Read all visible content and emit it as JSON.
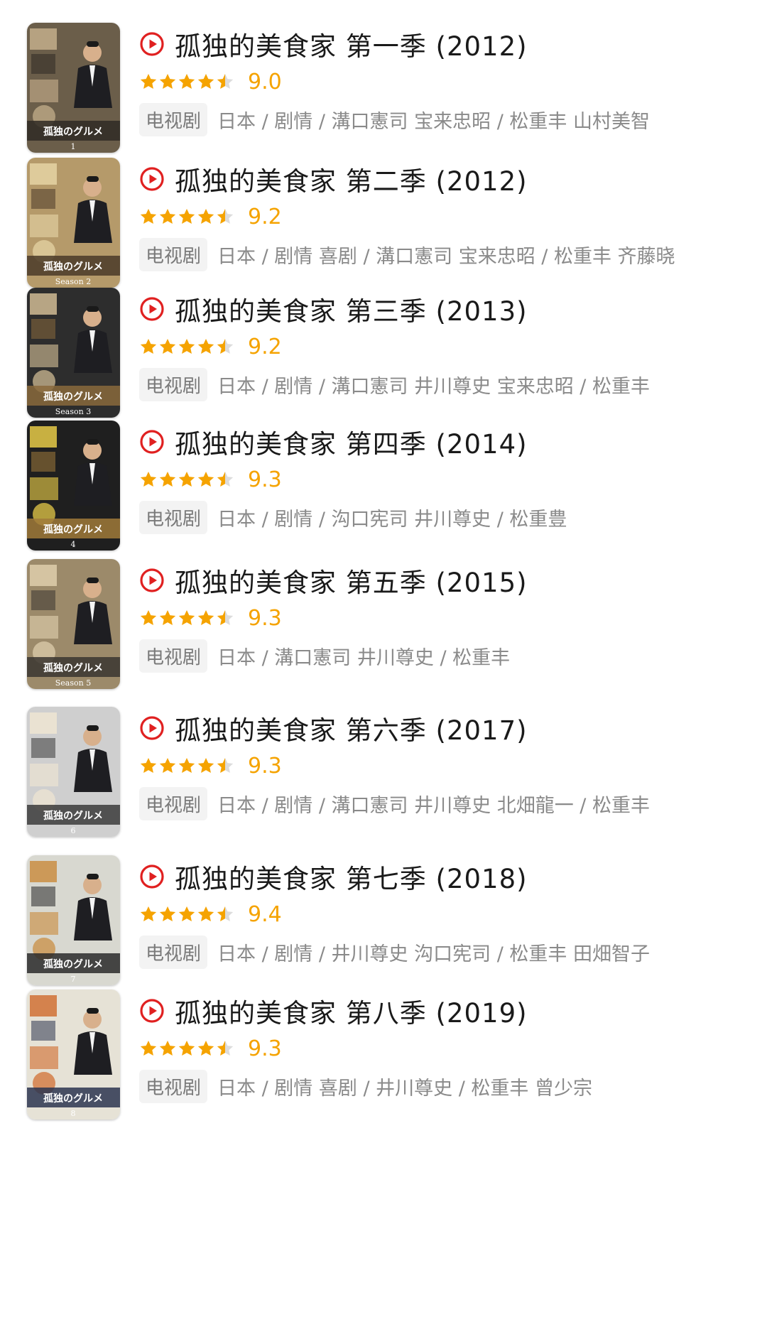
{
  "colors": {
    "accent_red": "#e02020",
    "star_orange": "#f5a300",
    "title_text": "#1a1a1a",
    "meta_text": "#8a8a8a"
  },
  "icons": {
    "play": "play-circle-icon",
    "star": "star-icon"
  },
  "items": [
    {
      "title": "孤独的美食家 第一季 (2012)",
      "rating_stars": 4.5,
      "score": "9.0",
      "tag": "电视剧",
      "meta": "日本 / 剧情 / 溝口憲司 宝来忠昭 / 松重丰 山村美智",
      "poster_palette": [
        "#6b5e4a",
        "#2f2a24",
        "#c9b38f"
      ],
      "poster_text": "1"
    },
    {
      "title": "孤独的美食家 第二季 (2012)",
      "rating_stars": 4.5,
      "score": "9.2",
      "tag": "电视剧",
      "meta": "日本 / 剧情 喜剧 / 溝口憲司 宝来忠昭 / 松重丰 齐藤晓",
      "poster_palette": [
        "#b59a6a",
        "#4a3a28",
        "#e8d7a8"
      ],
      "poster_text": "Season 2"
    },
    {
      "title": "孤独的美食家 第三季 (2013)",
      "rating_stars": 4.5,
      "score": "9.2",
      "tag": "电视剧",
      "meta": "日本 / 剧情 / 溝口憲司 井川尊史 宝来忠昭 / 松重丰",
      "poster_palette": [
        "#2d2d2d",
        "#8a6a3c",
        "#d9c39a"
      ],
      "poster_text": "Season 3"
    },
    {
      "title": "孤独的美食家 第四季 (2014)",
      "rating_stars": 4.5,
      "score": "9.3",
      "tag": "电视剧",
      "meta": "日本 / 剧情 / 沟口宪司 井川尊史 / 松重豊",
      "poster_palette": [
        "#1f1f1f",
        "#a07a3a",
        "#f2d44a"
      ],
      "poster_text": "4"
    },
    {
      "title": "孤独的美食家 第五季 (2015)",
      "rating_stars": 4.5,
      "score": "9.3",
      "tag": "电视剧",
      "meta": "日本 / 溝口憲司 井川尊史 / 松重丰",
      "poster_palette": [
        "#9c8a6a",
        "#3a3530",
        "#e3d2b0"
      ],
      "poster_text": "Season 5"
    },
    {
      "title": "孤独的美食家 第六季 (2017)",
      "rating_stars": 4.5,
      "score": "9.3",
      "tag": "电视剧",
      "meta": "日本 / 剧情 / 溝口憲司 井川尊史 北畑龍一 / 松重丰",
      "poster_palette": [
        "#cfcfcf",
        "#3b3b3b",
        "#f0e6d2"
      ],
      "poster_text": "6"
    },
    {
      "title": "孤独的美食家 第七季 (2018)",
      "rating_stars": 4.5,
      "score": "9.4",
      "tag": "电视剧",
      "meta": "日本 / 剧情 / 井川尊史 沟口宪司 / 松重丰 田畑智子",
      "poster_palette": [
        "#d8d8d0",
        "#2a2a2a",
        "#c98a3a"
      ],
      "poster_text": "7"
    },
    {
      "title": "孤独的美食家 第八季 (2019)",
      "rating_stars": 4.5,
      "score": "9.3",
      "tag": "电视剧",
      "meta": "日本 / 剧情 喜剧 / 井川尊史 / 松重丰 曾少宗",
      "poster_palette": [
        "#e6e2d6",
        "#2c3550",
        "#d06a2a"
      ],
      "poster_text": "8"
    }
  ]
}
